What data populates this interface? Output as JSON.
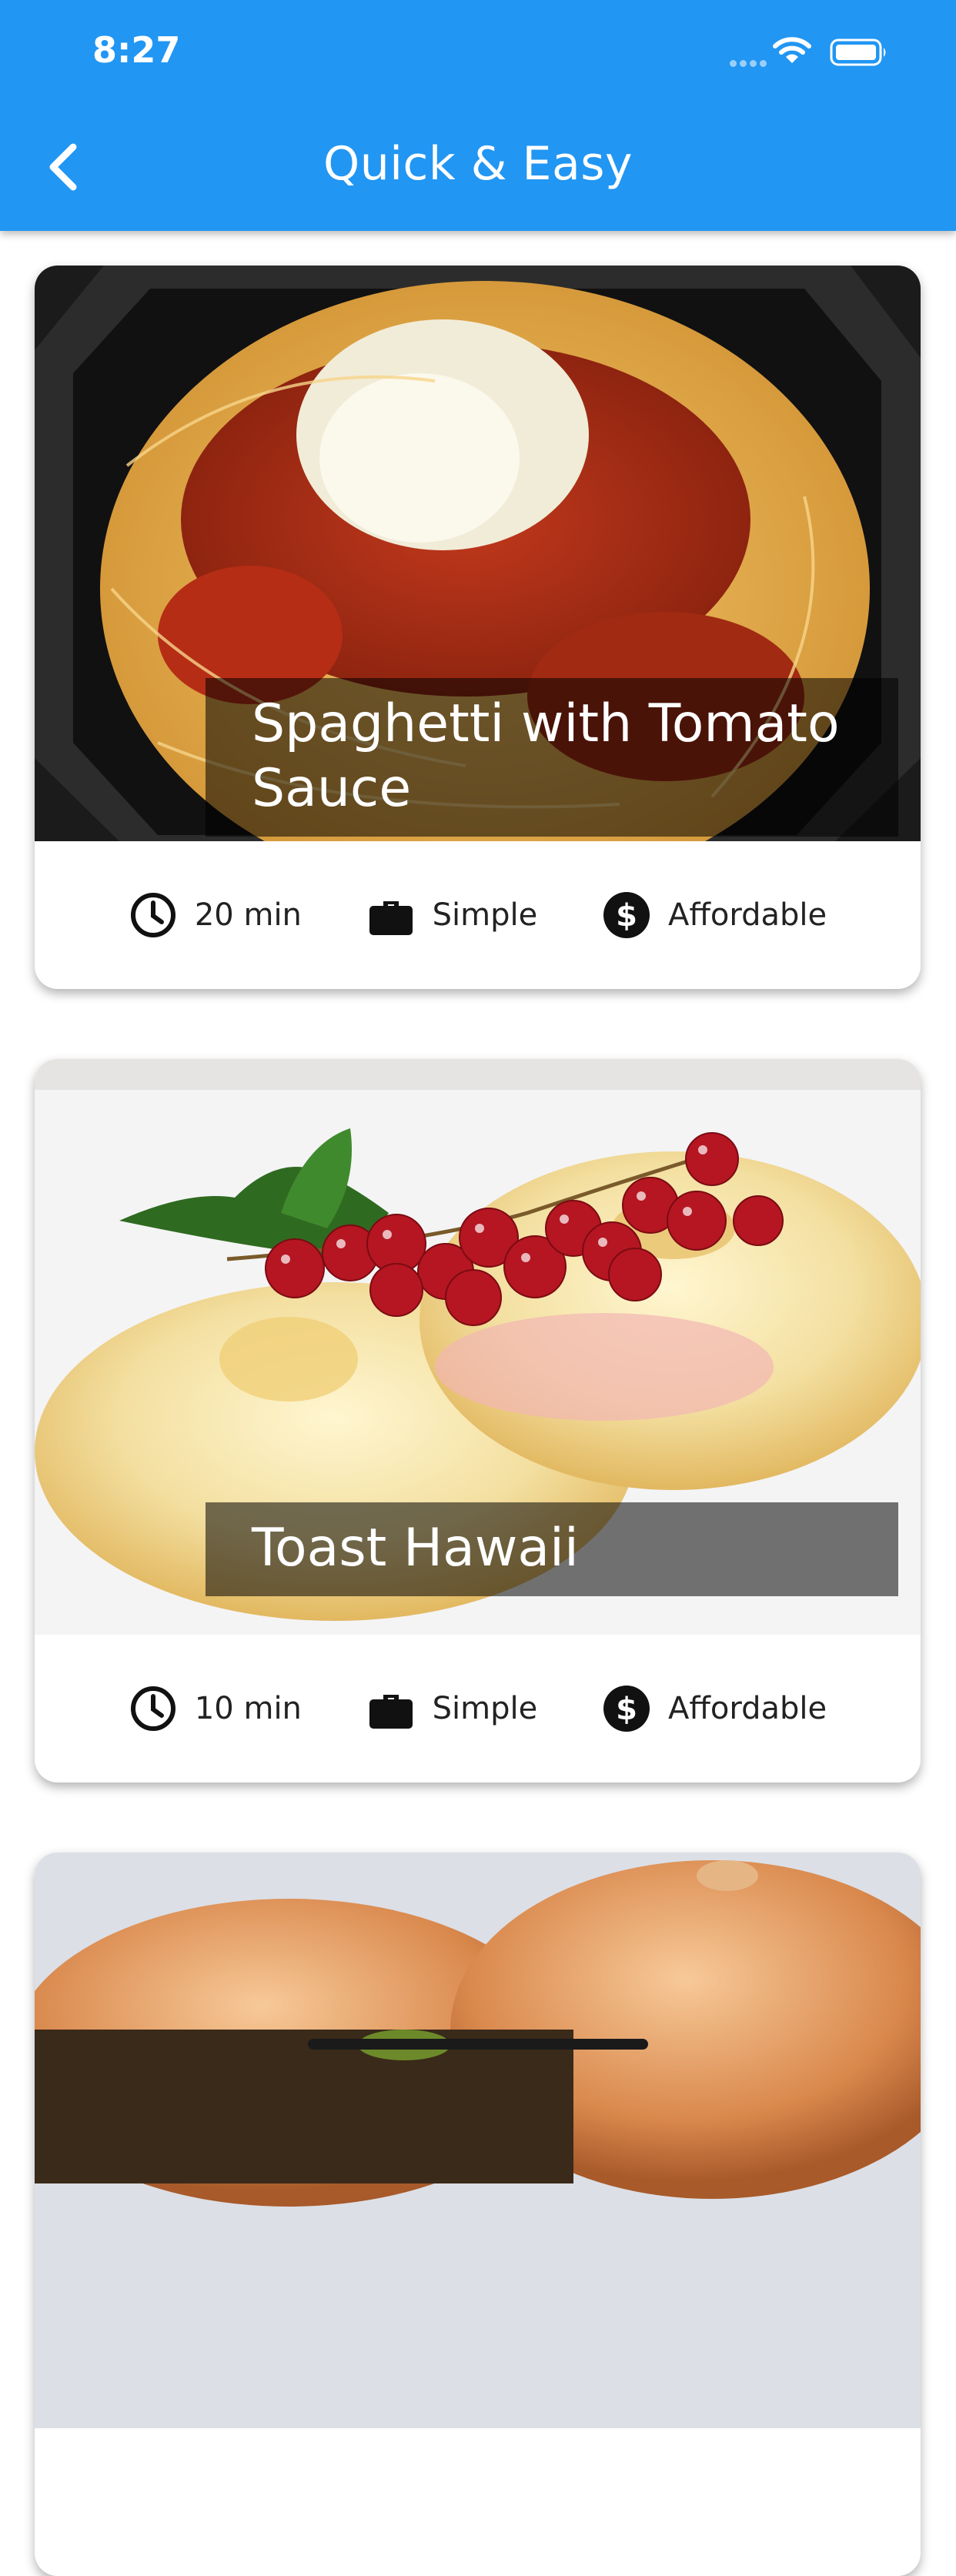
{
  "status_bar": {
    "time": "8:27"
  },
  "app_bar": {
    "title": "Quick & Easy",
    "back_icon": "chevron-left-icon"
  },
  "meals": [
    {
      "title": "Spaghetti with Tomato Sauce",
      "duration": "20 min",
      "complexity": "Simple",
      "affordability": "Affordable"
    },
    {
      "title": "Toast Hawaii",
      "duration": "10 min",
      "complexity": "Simple",
      "affordability": "Affordable"
    },
    {
      "title": "",
      "duration": "",
      "complexity": "",
      "affordability": ""
    }
  ],
  "icons": {
    "duration": "clock-icon",
    "complexity": "briefcase-icon",
    "affordability": "dollar-icon"
  },
  "colors": {
    "primary": "#2196f3",
    "on_primary": "#ffffff",
    "card_background": "#ffffff"
  }
}
